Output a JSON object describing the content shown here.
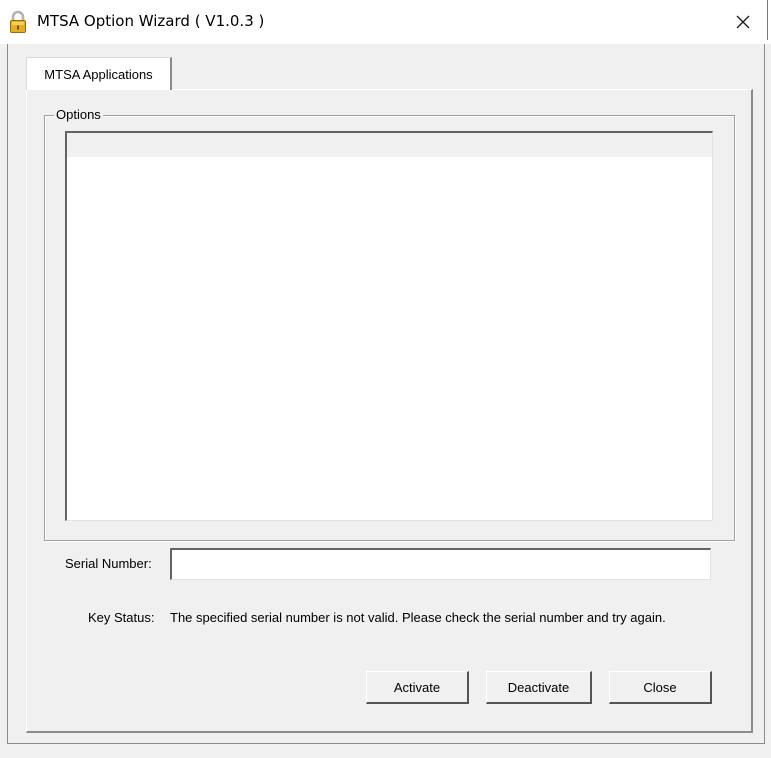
{
  "window": {
    "title": "MTSA Option Wizard ( V1.0.3 )",
    "icon": "lock-icon",
    "close_glyph": "✕"
  },
  "tabs": [
    {
      "label": "MTSA Applications",
      "selected": true
    }
  ],
  "options_group": {
    "label": "Options",
    "items": []
  },
  "serial": {
    "label": "Serial Number:",
    "value": ""
  },
  "key_status": {
    "label": "Key Status:",
    "message": "The specified serial number is not valid. Please check the serial number and try again."
  },
  "buttons": {
    "activate": "Activate",
    "deactivate": "Deactivate",
    "close": "Close"
  }
}
